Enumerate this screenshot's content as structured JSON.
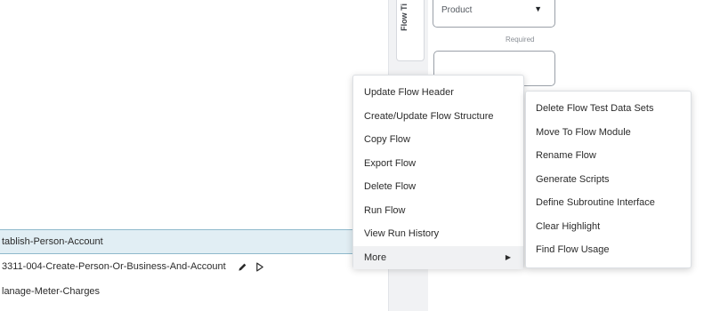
{
  "side_panel": {
    "vertical_tab_label": "Flow Ti",
    "product_select": {
      "value": "Product",
      "caret": "▼"
    },
    "required_label": "Required"
  },
  "flow_list": {
    "rows": [
      {
        "label": "tablish-Person-Account",
        "selected": true
      },
      {
        "label": "3311-004-Create-Person-Or-Business-And-Account",
        "selected": false,
        "actions": [
          "pencil-icon",
          "play-icon"
        ]
      },
      {
        "label": "lanage-Meter-Charges",
        "selected": false
      }
    ]
  },
  "context_menu": {
    "items": [
      {
        "label": "Update Flow Header"
      },
      {
        "label": "Create/Update Flow Structure"
      },
      {
        "label": "Copy Flow"
      },
      {
        "label": "Export Flow"
      },
      {
        "label": "Delete Flow"
      },
      {
        "label": "Run Flow"
      },
      {
        "label": "View Run History"
      },
      {
        "label": "More",
        "submenu_arrow": "▶"
      }
    ]
  },
  "submenu": {
    "items": [
      {
        "label": "Delete Flow Test Data Sets"
      },
      {
        "label": "Move To Flow Module"
      },
      {
        "label": "Rename Flow"
      },
      {
        "label": "Generate Scripts"
      },
      {
        "label": "Define Subroutine Interface"
      },
      {
        "label": "Clear Highlight"
      },
      {
        "label": "Find Flow Usage"
      }
    ]
  },
  "colors": {
    "selected_row_bg": "#e1eef4",
    "selected_row_border": "#8fb9cc",
    "menu_hover_bg": "#f0f1f3"
  }
}
